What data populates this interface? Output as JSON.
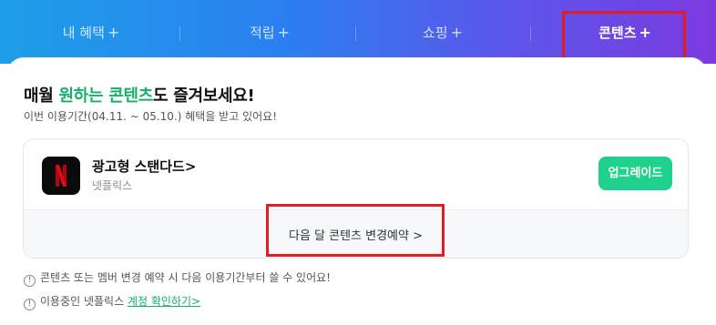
{
  "tabs": [
    {
      "label": "내 혜택",
      "plus": "+"
    },
    {
      "label": "적립",
      "plus": "+"
    },
    {
      "label": "쇼핑",
      "plus": "+"
    },
    {
      "label": "콘텐츠",
      "plus": "+"
    }
  ],
  "active_tab": "콘텐츠",
  "headline": {
    "part1": "매월 ",
    "highlight1": "원하는",
    "part2": " ",
    "highlight2": "콘텐츠",
    "part3": "도 즐겨보세요!"
  },
  "period_text": "이번 이용기간(04.11. ~ 05.10.) 혜택을 받고 있어요!",
  "card": {
    "logo_letter": "N",
    "plan_name": "광고형 스탠다드>",
    "plan_provider": "넷플릭스",
    "upgrade_label": "업그레이드",
    "change_link": "다음 달 콘텐츠 변경예약 >"
  },
  "notices": {
    "notice1": "콘텐츠 또는 멤버 변경 예약 시 다음 이용기간부터 쓸 수 있어요!",
    "notice2_prefix": "이용중인 넷플릭스 ",
    "notice2_link": "계정 확인하기>",
    "info_glyph": "!"
  },
  "colors": {
    "accent_green": "#16b06b",
    "button_green": "#1fd18a",
    "annotation_red": "#e11c24",
    "netflix_red": "#e50914"
  }
}
